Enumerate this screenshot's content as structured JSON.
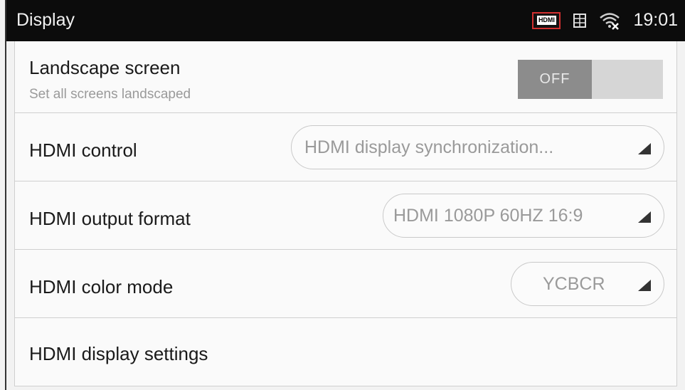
{
  "statusbar": {
    "title": "Display",
    "hdmi_icon_text": "HDMI",
    "time": "19:01",
    "icons": [
      "hdmi-icon",
      "grid-icon",
      "wifi-icon"
    ]
  },
  "settings": {
    "landscape": {
      "label": "Landscape screen",
      "sublabel": "Set all screens landscaped",
      "toggle_state": "OFF"
    },
    "hdmi_control": {
      "label": "HDMI control",
      "value": "HDMI display synchronization..."
    },
    "hdmi_output_format": {
      "label": "HDMI output format",
      "value": "HDMI 1080P 60HZ 16:9"
    },
    "hdmi_color_mode": {
      "label": "HDMI color mode",
      "value": "YCBCR"
    },
    "hdmi_display_settings": {
      "label": "HDMI display settings"
    }
  },
  "colors": {
    "statusbar_bg": "#0c0c0c",
    "hdmi_icon_border": "#d23030",
    "toggle_knob": "#8c8c8c",
    "toggle_track": "#d6d6d6"
  }
}
